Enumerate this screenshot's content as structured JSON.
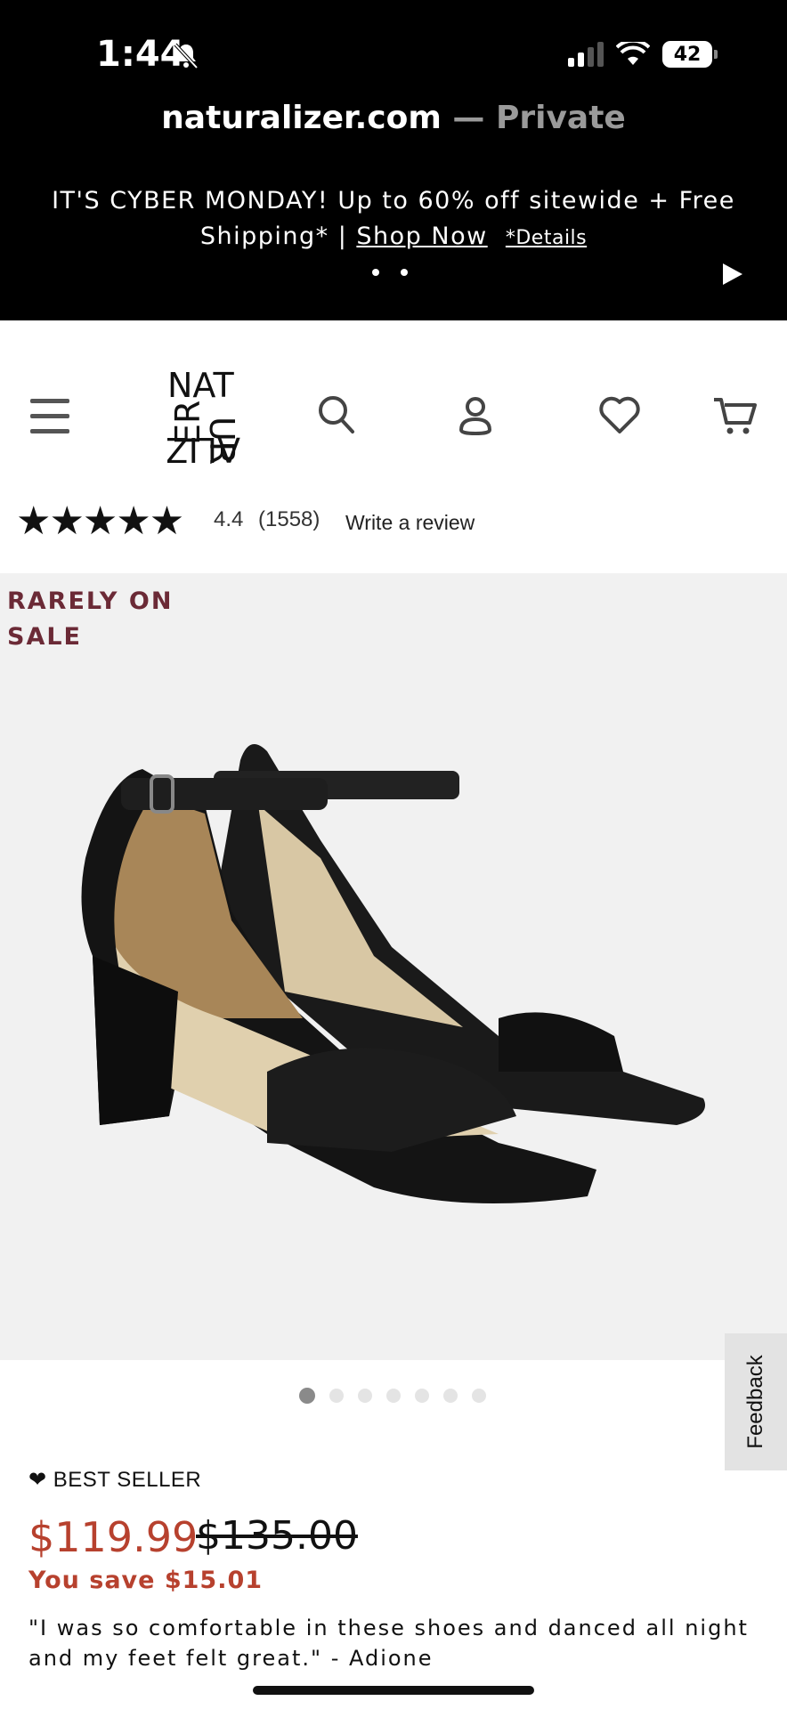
{
  "status_bar": {
    "time": "1:44",
    "battery": "42"
  },
  "browser": {
    "domain": "naturalizer.com",
    "separator": " — ",
    "mode": "Private"
  },
  "promo": {
    "text": "IT'S CYBER MONDAY! Up to 60% off sitewide + Free Shipping* | ",
    "shop_now": "Shop Now",
    "details": "*Details"
  },
  "header": {
    "logo_text": "NATURALIZER",
    "icons": [
      "menu-icon",
      "search-icon",
      "account-icon",
      "heart-icon",
      "cart-icon"
    ]
  },
  "rating": {
    "stars": "★★★★★",
    "value": "4.4",
    "count": "(1558)",
    "write_review": "Write a review"
  },
  "product": {
    "badge": "RARELY ON SALE",
    "best_seller": "BEST SELLER",
    "price": "$119.99",
    "old_price": "$135.00",
    "savings": "You save $15.01",
    "quote": "\"I was so comfortable in these shoes and danced all night and my feet felt great.\" - Adione",
    "image_count": 7,
    "active_image": 1
  },
  "feedback": {
    "label": "Feedback"
  },
  "colors": {
    "sale_red": "#b7412e",
    "badge_maroon": "#6b2a36",
    "image_bg": "#f1f1f1"
  }
}
